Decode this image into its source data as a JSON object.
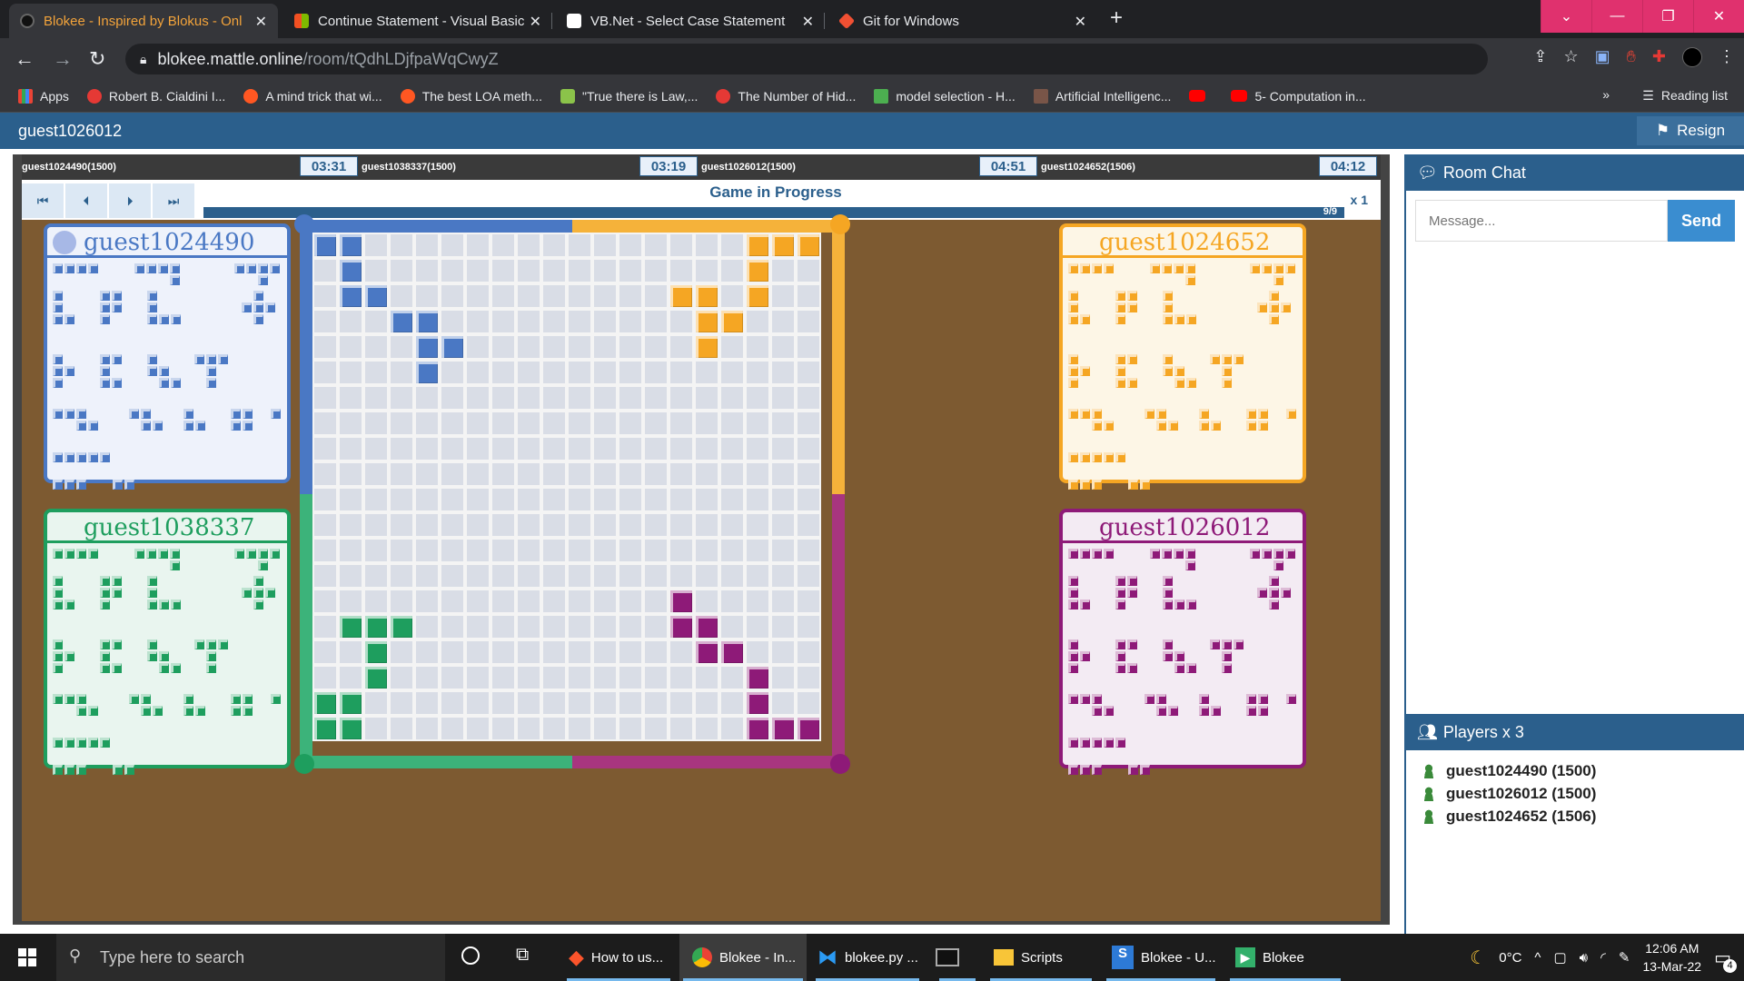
{
  "browser": {
    "tabs": [
      {
        "title": "Blokee - Inspired by Blokus - Onl",
        "active": true
      },
      {
        "title": "Continue Statement - Visual Basic",
        "active": false
      },
      {
        "title": "VB.Net - Select Case Statement",
        "active": false
      },
      {
        "title": "Git for Windows",
        "active": false
      }
    ],
    "url_host": "blokee.mattle.online",
    "url_path": "/room/tQdhLDjfpaWqCwyZ",
    "bookmarks": [
      {
        "label": "Apps",
        "color": "#ea4335"
      },
      {
        "label": "Robert B. Cialdini I...",
        "color": "#e53935"
      },
      {
        "label": "A mind trick that wi...",
        "color": "#ff5722"
      },
      {
        "label": "The best LOA meth...",
        "color": "#ff5722"
      },
      {
        "label": "\"True there is Law,...",
        "color": "#8bc34a"
      },
      {
        "label": "The Number of Hid...",
        "color": "#e53935"
      },
      {
        "label": "model selection - H...",
        "color": "#4caf50"
      },
      {
        "label": "Artificial Intelligenc...",
        "color": "#795548"
      },
      {
        "label": "",
        "color": "#ff0000"
      },
      {
        "label": "5- Computation in...",
        "color": "#ff0000"
      }
    ],
    "reading_list": "Reading list"
  },
  "app": {
    "username": "guest1026012",
    "resign_label": "Resign",
    "status": "Game in Progress",
    "progress_label": "9/9",
    "speed": "x 1",
    "timers": [
      {
        "player": "guest1024490(1500)",
        "time": "03:31"
      },
      {
        "player": "guest1038337(1500)",
        "time": "03:19"
      },
      {
        "player": "guest1026012(1500)",
        "time": "04:51"
      },
      {
        "player": "guest1024652(1506)",
        "time": "04:12"
      }
    ],
    "panels": {
      "blue": {
        "name": "guest1024490",
        "color": "#4a78c4",
        "bg": "#eef2fb"
      },
      "orange": {
        "name": "guest1024652",
        "color": "#f5a623",
        "bg": "#fdf6e6"
      },
      "green": {
        "name": "guest1038337",
        "color": "#1e9e5e",
        "bg": "#e9f5ef"
      },
      "purple": {
        "name": "guest1026012",
        "color": "#8e1a78",
        "bg": "#f3ebf3"
      }
    }
  },
  "chat": {
    "title": "Room Chat",
    "placeholder": "Message...",
    "send_label": "Send",
    "players_title": "Players x 3",
    "players": [
      "guest1024490 (1500)",
      "guest1026012 (1500)",
      "guest1024652 (1506)"
    ]
  },
  "taskbar": {
    "search_placeholder": "Type here to search",
    "items": [
      "How to us...",
      "Blokee - In...",
      "blokee.py ...",
      "",
      "Scripts",
      "Blokee - U...",
      "Blokee"
    ],
    "temperature": "0°C",
    "time": "12:06 AM",
    "date": "13-Mar-22",
    "notifications": "4"
  }
}
